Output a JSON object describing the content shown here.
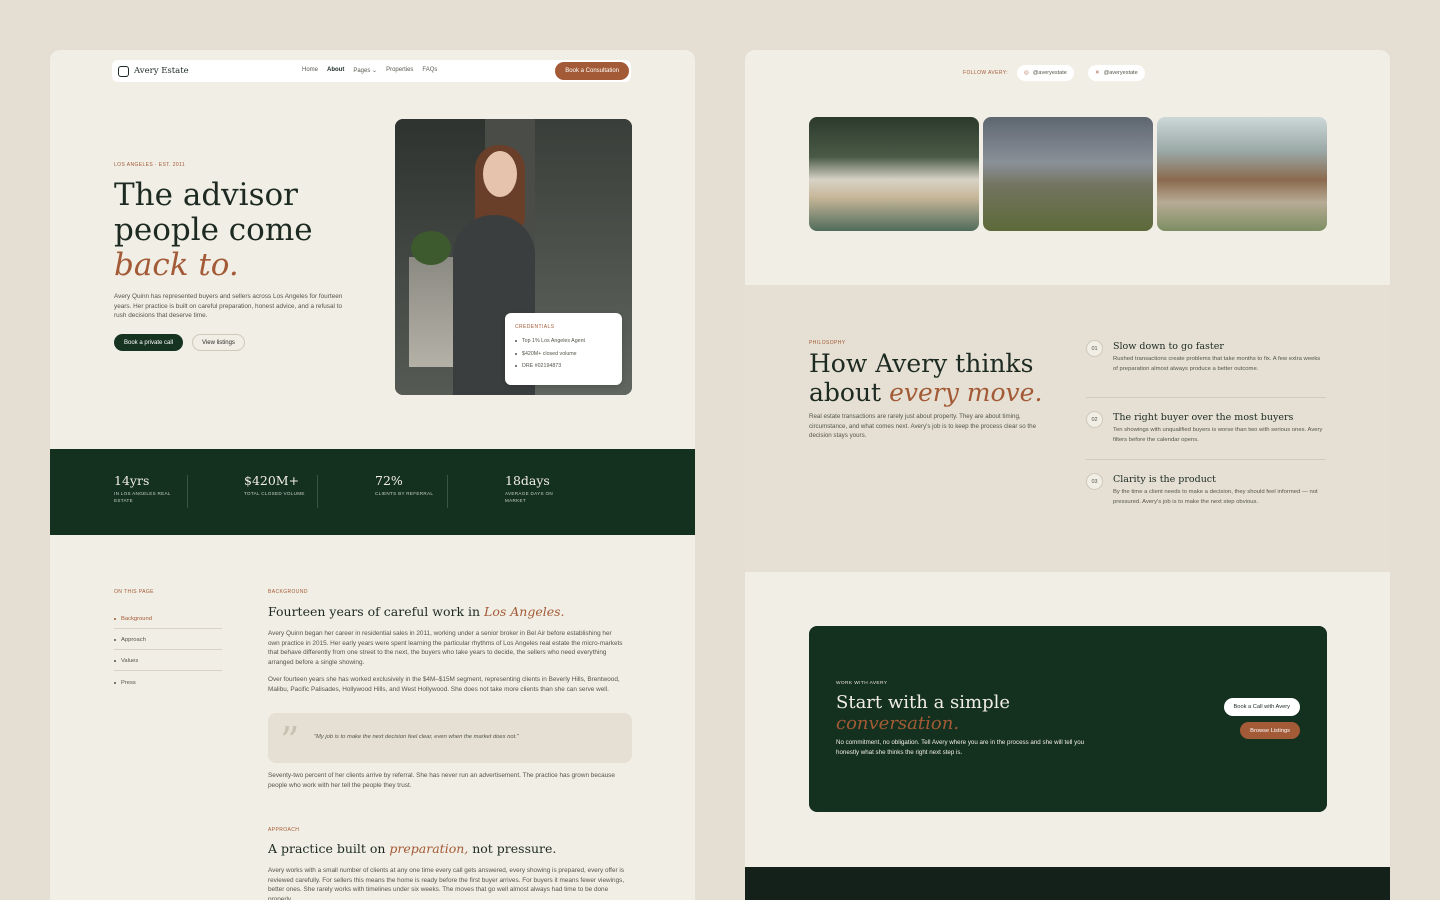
{
  "nav": {
    "logo": "Avery Estate",
    "links": [
      "Home",
      "About",
      "Pages",
      "Properties",
      "FAQs"
    ],
    "active": "About",
    "cta": "Book a Consultation"
  },
  "hero": {
    "eyebrow": "LOS ANGELES · EST. 2011",
    "title_line1": "The advisor",
    "title_line2": "people come",
    "title_line3": "back to.",
    "body": "Avery Quinn has represented buyers and sellers across Los Angeles for fourteen years. Her practice is built on careful preparation, honest advice, and a refusal to rush decisions that deserve time.",
    "primary_button": "Book a private call",
    "secondary_button": "View listings"
  },
  "credentials": {
    "label": "CREDENTIALS",
    "items": [
      "Top 1% Los Angeles Agent",
      "$420M+ closed volume",
      "DRE #02194873"
    ]
  },
  "stats": [
    {
      "value": "14yrs",
      "label": "IN LOS ANGELES REAL ESTATE"
    },
    {
      "value": "$420M+",
      "label": "TOTAL CLOSED VOLUME"
    },
    {
      "value": "72%",
      "label": "CLIENTS BY REFERRAL"
    },
    {
      "value": "18days",
      "label": "AVERAGE DAYS ON MARKET"
    }
  ],
  "on_this_page": {
    "label": "ON THIS PAGE",
    "items": [
      "Background",
      "Approach",
      "Values",
      "Press"
    ]
  },
  "background": {
    "eyebrow": "BACKGROUND",
    "title": "Fourteen years of careful work in ",
    "title_italic": "Los Angeles.",
    "p1": "Avery Quinn began her career in residential sales in 2011, working under a senior broker in Bel Air before establishing her own practice in 2015. Her early years were spent learning the particular rhythms of Los Angeles real estate the micro-markets that behave differently from one street to the next, the buyers who take years to decide, the sellers who need everything arranged before a single showing.",
    "p2": "Over fourteen years she has worked exclusively in the $4M–$15M segment, representing clients in Beverly Hills, Brentwood, Malibu, Pacific Palisades, Hollywood Hills, and West Hollywood. She does not take more clients than she can serve well.",
    "quote": "\"My job is to make the next decision feel clear, even when the market does not.\"",
    "p3": "Seventy-two percent of her clients arrive by referral. She has never run an advertisement. The practice has grown because people who work with her tell the people they trust."
  },
  "approach": {
    "eyebrow": "APPROACH",
    "title_a": "A practice built on ",
    "title_italic": "preparation,",
    "title_b": " not pressure.",
    "p1": "Avery works with a small number of clients at any one time every call gets answered, every showing is prepared, every offer is reviewed carefully. For sellers this means the home is ready before the first buyer arrives. For buyers it means fewer viewings, better ones. She rarely works with timelines under six weeks. The moves that go well almost always had time to be done properly."
  },
  "follow": {
    "label": "FOLLOW AVERY",
    "instagram": "@averyestate",
    "x": "@averyestate"
  },
  "philosophy": {
    "eyebrow": "PHILOSOPHY",
    "title_a": "How Avery thinks",
    "title_b": "about ",
    "title_italic": "every move.",
    "body": "Real estate transactions are rarely just about property. They are about timing, circumstance, and what comes next. Avery's job is to keep the process clear so the decision stays yours.",
    "items": [
      {
        "num": "01",
        "title": "Slow down to go faster",
        "desc": "Rushed transactions create problems that take months to fix. A few extra weeks of preparation almost always produce a better outcome."
      },
      {
        "num": "02",
        "title": "The right buyer over the most buyers",
        "desc": "Ten showings with unqualified buyers is worse than two with serious ones. Avery filters before the calendar opens."
      },
      {
        "num": "03",
        "title": "Clarity is the product",
        "desc": "By the time a client needs to make a decision, they should feel informed — not pressured. Avery's job is to make the next step obvious."
      }
    ]
  },
  "cta": {
    "eyebrow": "WORK WITH AVERY",
    "title": "Start with a simple",
    "title_italic": "conversation.",
    "body": "No commitment, no obligation. Tell Avery where you are in the process and she will tell you honestly what she thinks the right next step is.",
    "button_primary": "Book a Call with Avery",
    "button_secondary": "Browse Listings"
  },
  "colors": {
    "accent": "#a35a36",
    "dark_green": "#14301f",
    "cream": "#f1eee5",
    "sand": "#e5e0d3"
  }
}
